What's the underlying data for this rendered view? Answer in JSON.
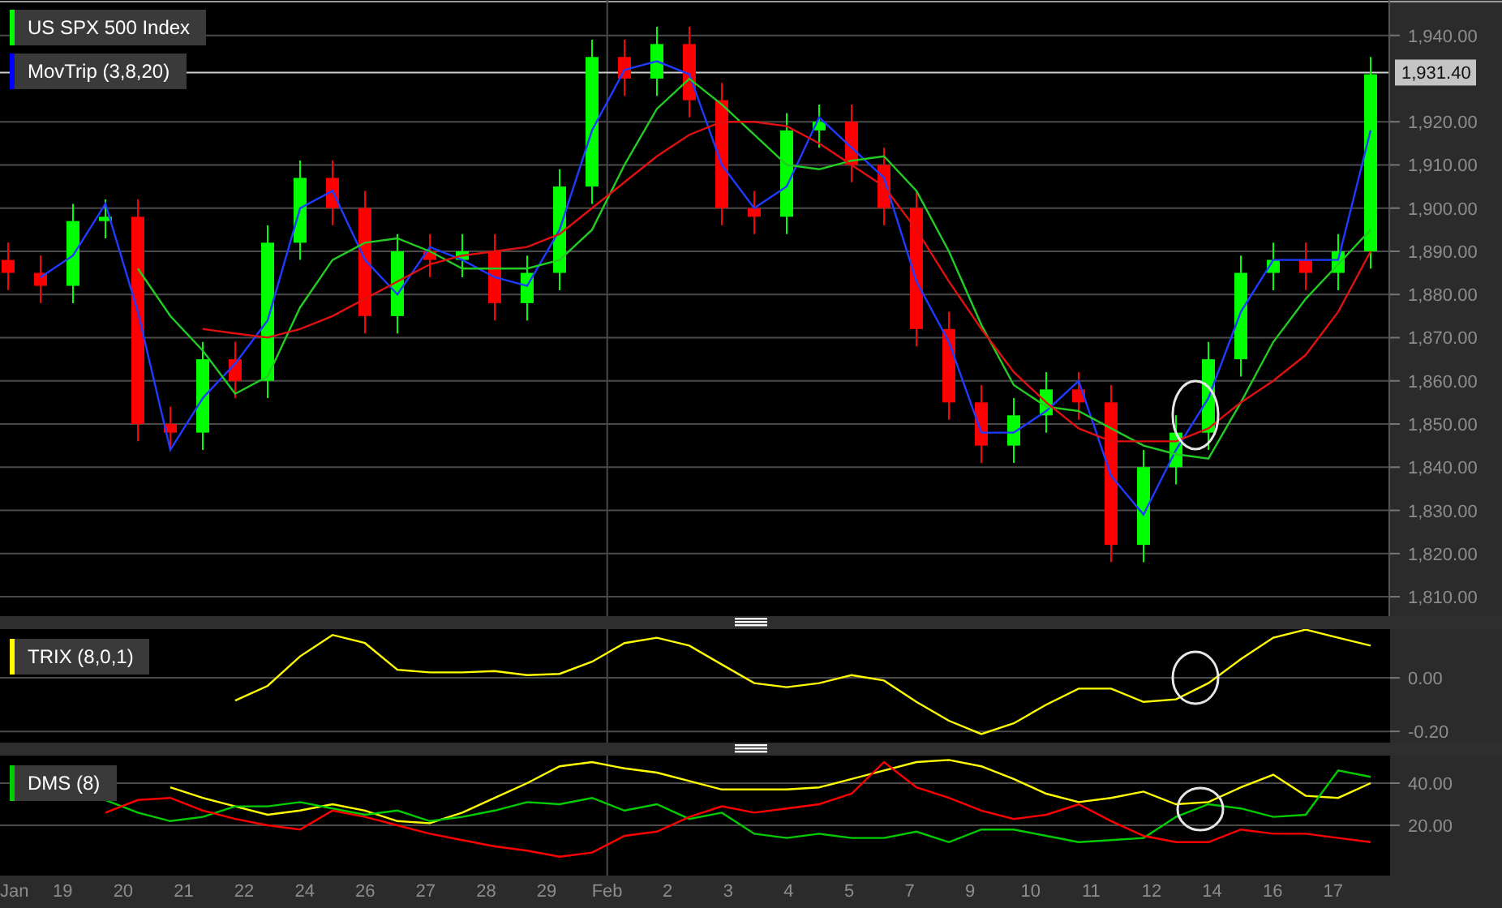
{
  "panels": [
    {
      "legend": [
        {
          "label": "US SPX 500 Index",
          "color": "#00ff00"
        },
        {
          "label": "MovTrip (3,8,20)",
          "color": "#0000ff"
        }
      ],
      "highlight": true,
      "chart_data": {
        "type": "candlestick",
        "grid": true,
        "ylim": [
          1805.5,
          1948.2
        ],
        "ohlc": [
          [
            1888,
            1892,
            1881,
            1885
          ],
          [
            1885,
            1889,
            1878,
            1882
          ],
          [
            1882,
            1901,
            1878,
            1897
          ],
          [
            1897,
            1902,
            1893,
            1898
          ],
          [
            1898,
            1902,
            1846,
            1850
          ],
          [
            1850,
            1854,
            1844,
            1848
          ],
          [
            1848,
            1869,
            1844,
            1865
          ],
          [
            1865,
            1869,
            1856,
            1860
          ],
          [
            1860,
            1896,
            1856,
            1892
          ],
          [
            1892,
            1911,
            1888,
            1907
          ],
          [
            1907,
            1911,
            1896,
            1900
          ],
          [
            1900,
            1904,
            1871,
            1875
          ],
          [
            1875,
            1894,
            1871,
            1890
          ],
          [
            1890,
            1894,
            1884,
            1888
          ],
          [
            1888,
            1894,
            1884,
            1890
          ],
          [
            1890,
            1894,
            1874,
            1878
          ],
          [
            1878,
            1889,
            1874,
            1885
          ],
          [
            1885,
            1909,
            1881,
            1905
          ],
          [
            1905,
            1939,
            1901,
            1935
          ],
          [
            1935,
            1939,
            1926,
            1930
          ],
          [
            1930,
            1942,
            1926,
            1938
          ],
          [
            1938,
            1942,
            1921,
            1925
          ],
          [
            1925,
            1929,
            1896,
            1900
          ],
          [
            1900,
            1904,
            1894,
            1898
          ],
          [
            1898,
            1922,
            1894,
            1918
          ],
          [
            1918,
            1924,
            1914,
            1920
          ],
          [
            1920,
            1924,
            1906,
            1910
          ],
          [
            1910,
            1914,
            1896,
            1900
          ],
          [
            1900,
            1904,
            1868,
            1872
          ],
          [
            1872,
            1876,
            1851,
            1855
          ],
          [
            1855,
            1859,
            1841,
            1845
          ],
          [
            1845,
            1856,
            1841,
            1852
          ],
          [
            1852,
            1862,
            1848,
            1858
          ],
          [
            1858,
            1862,
            1851,
            1855
          ],
          [
            1855,
            1859,
            1818,
            1822
          ],
          [
            1822,
            1844,
            1818,
            1840
          ],
          [
            1840,
            1852,
            1836,
            1848
          ],
          [
            1848,
            1869,
            1844,
            1865
          ],
          [
            1865,
            1889,
            1861,
            1885
          ],
          [
            1885,
            1892,
            1881,
            1888
          ],
          [
            1888,
            1892,
            1881,
            1885
          ],
          [
            1885,
            1894,
            1881,
            1890
          ],
          [
            1890,
            1935,
            1886,
            1931
          ]
        ],
        "yticks": [
          {
            "value": 1940,
            "label": "1,940.00"
          },
          {
            "value": 1920,
            "label": "1,920.00"
          },
          {
            "value": 1910,
            "label": "1,910.00"
          },
          {
            "value": 1900,
            "label": "1,900.00"
          },
          {
            "value": 1890,
            "label": "1,890.00"
          },
          {
            "value": 1880,
            "label": "1,880.00"
          },
          {
            "value": 1870,
            "label": "1,870.00"
          },
          {
            "value": 1860,
            "label": "1,860.00"
          },
          {
            "value": 1850,
            "label": "1,850.00"
          },
          {
            "value": 1840,
            "label": "1,840.00"
          },
          {
            "value": 1830,
            "label": "1,830.00"
          },
          {
            "value": 1820,
            "label": "1,820.00"
          },
          {
            "value": 1810,
            "label": "1,810.00"
          }
        ],
        "ref_lines": [
          {
            "axis": "y",
            "value": 1931.4,
            "label": "1,931.40"
          }
        ]
      },
      "overlay": {
        "chart_data": {
          "type": "line",
          "ylim": [
            1805.5,
            1948.2
          ],
          "series": [
            {
              "color": "#1f3bff",
              "values": [
                null,
                1884,
                1889,
                1901,
                1876,
                1844,
                1856,
                1864,
                1874,
                1900,
                1904,
                1888,
                1880,
                1891,
                1888,
                1884,
                1882,
                1895,
                1918,
                1932,
                1934,
                1931,
                1910,
                1900,
                1905,
                1921,
                1914,
                1907,
                1883,
                1869,
                1848,
                1848,
                1853,
                1860,
                1838,
                1829,
                1844,
                1856,
                1876,
                1888,
                1888,
                1888,
                1918
              ]
            },
            {
              "color": "#22cc22",
              "values": [
                null,
                null,
                null,
                null,
                1886,
                1875,
                1867,
                1857,
                1861,
                1877,
                1888,
                1892,
                1893,
                1890,
                1886,
                1886,
                1886,
                1888,
                1895,
                1910,
                1923,
                1930,
                1924,
                1917,
                1910,
                1909,
                1911,
                1912,
                1904,
                1890,
                1873,
                1859,
                1854,
                1853,
                1849,
                1845,
                1843,
                1842,
                1855,
                1869,
                1879,
                1887,
                1895
              ]
            },
            {
              "color": "#e01010",
              "values": [
                null,
                null,
                null,
                null,
                null,
                null,
                1872,
                1871,
                1870,
                1872,
                1875,
                1879,
                1883,
                1887,
                1889,
                1890,
                1891,
                1894,
                1900,
                1906,
                1912,
                1917,
                1920,
                1920,
                1919,
                1915,
                1910,
                1905,
                1895,
                1883,
                1872,
                1862,
                1855,
                1849,
                1846,
                1846,
                1846,
                1849,
                1855,
                1860,
                1866,
                1876,
                1890
              ]
            }
          ]
        }
      }
    },
    {
      "legend": [
        {
          "label": "TRIX (8,0,1)",
          "color": "#ffff00"
        }
      ],
      "highlight": true,
      "chart_data": {
        "type": "line",
        "grid": true,
        "ylim": [
          -0.242,
          0.182
        ],
        "yticks": [
          {
            "value": 0,
            "label": "0.00"
          },
          {
            "value": -0.2,
            "label": "-0.20"
          }
        ],
        "series": [
          {
            "color": "#ffff00",
            "values": [
              null,
              null,
              null,
              null,
              null,
              null,
              null,
              -0.085,
              -0.03,
              0.08,
              0.16,
              0.13,
              0.03,
              0.02,
              0.02,
              0.025,
              0.01,
              0.015,
              0.06,
              0.13,
              0.15,
              0.12,
              0.05,
              -0.02,
              -0.035,
              -0.02,
              0.01,
              -0.01,
              -0.09,
              -0.16,
              -0.21,
              -0.17,
              -0.1,
              -0.04,
              -0.04,
              -0.09,
              -0.08,
              -0.02,
              0.07,
              0.15,
              0.18,
              0.15,
              0.12
            ]
          }
        ]
      }
    },
    {
      "legend": [
        {
          "label": "DMS (8)",
          "color": "#00cc00"
        }
      ],
      "highlight": true,
      "chart_data": {
        "type": "line",
        "grid": true,
        "ylim": [
          -3.9,
          53.1
        ],
        "yticks": [
          {
            "value": 40,
            "label": "40.00"
          },
          {
            "value": 20,
            "label": "20.00"
          }
        ],
        "series": [
          {
            "color": "#ffff00",
            "values": [
              null,
              null,
              null,
              null,
              null,
              38,
              33,
              29,
              25,
              27,
              30,
              27,
              22,
              21,
              26,
              33,
              40,
              48,
              50,
              47,
              45,
              41,
              37,
              37,
              37,
              38,
              42,
              46,
              50,
              51,
              48,
              42,
              35,
              31,
              33,
              36,
              30,
              31,
              38,
              44,
              34,
              33,
              40
            ]
          },
          {
            "color": "#00cc00",
            "values": [
              null,
              null,
              null,
              32,
              26,
              22,
              24,
              29,
              29,
              31,
              28,
              25,
              27,
              22,
              24,
              27,
              31,
              30,
              33,
              27,
              30,
              23,
              26,
              16,
              14,
              16,
              14,
              14,
              17,
              12,
              18,
              18,
              15,
              12,
              13,
              14,
              24,
              30,
              28,
              24,
              25,
              46,
              43
            ]
          },
          {
            "color": "#ff0000",
            "values": [
              null,
              null,
              null,
              26,
              32,
              33,
              27,
              23,
              20,
              18,
              27,
              24,
              20,
              16,
              13,
              10,
              8,
              5,
              7,
              15,
              17,
              24,
              29,
              26,
              28,
              30,
              35,
              50,
              38,
              33,
              27,
              23,
              25,
              30,
              22,
              15,
              12,
              12,
              18,
              16,
              16,
              14,
              12
            ]
          }
        ]
      }
    }
  ],
  "time_axis": [
    {
      "label": "Jan",
      "kind": "month"
    },
    {
      "label": "19",
      "kind": "day"
    },
    {
      "label": "20",
      "kind": "day"
    },
    {
      "label": "21",
      "kind": "day"
    },
    {
      "label": "22",
      "kind": "day"
    },
    {
      "label": "24",
      "kind": "day"
    },
    {
      "label": "26",
      "kind": "day"
    },
    {
      "label": "27",
      "kind": "day"
    },
    {
      "label": "28",
      "kind": "day"
    },
    {
      "label": "29",
      "kind": "day"
    },
    {
      "label": "Feb",
      "kind": "month"
    },
    {
      "label": "2",
      "kind": "day"
    },
    {
      "label": "3",
      "kind": "day"
    },
    {
      "label": "4",
      "kind": "day"
    },
    {
      "label": "5",
      "kind": "day"
    },
    {
      "label": "7",
      "kind": "day"
    },
    {
      "label": "9",
      "kind": "day"
    },
    {
      "label": "10",
      "kind": "day"
    },
    {
      "label": "11",
      "kind": "day"
    },
    {
      "label": "12",
      "kind": "day"
    },
    {
      "label": "14",
      "kind": "day"
    },
    {
      "label": "16",
      "kind": "day"
    },
    {
      "label": "17",
      "kind": "day"
    }
  ]
}
